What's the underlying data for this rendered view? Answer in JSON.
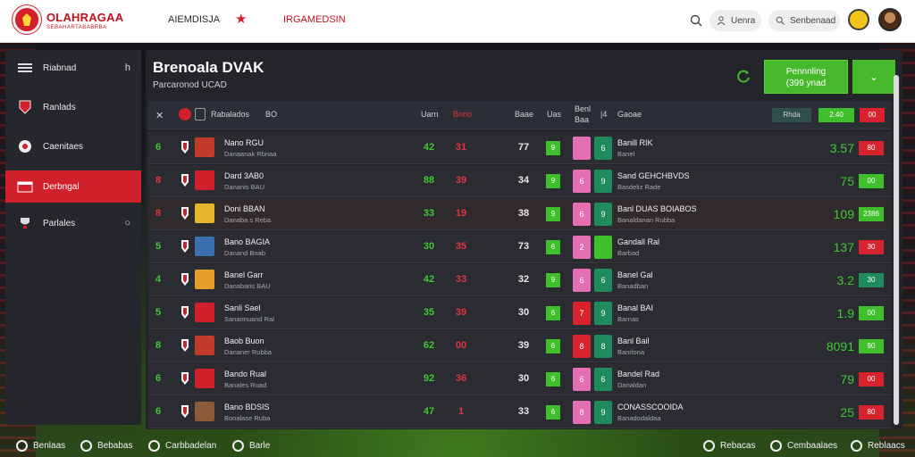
{
  "header": {
    "brand_title": "OLAHRAGAA",
    "brand_sub": "SEBAHARTABABRBA",
    "nav_primary": "AIEMDISJA",
    "nav_secondary": "IRGAMEDSIN",
    "pill_1": "Uenra",
    "pill_2": "Senbenaad"
  },
  "sidebar": {
    "items": [
      {
        "label": "Riabnad",
        "trail": "h"
      },
      {
        "label": "Ranlads",
        "trail": ""
      },
      {
        "label": "Caenitaes",
        "trail": ""
      },
      {
        "label": "Derbngal",
        "trail": ""
      },
      {
        "label": "Parlales",
        "trail": "○"
      }
    ]
  },
  "main": {
    "title": "Brenoala DVAK",
    "subtitle": "Parcaronod UCAD",
    "btn_primary_line1": "Pennnling",
    "btn_primary_line2": "(399 ynad",
    "btn_square": "⌄"
  },
  "table": {
    "headers": {
      "col_a": "Rabalados",
      "col_b": "BO",
      "col_c": "Uarn",
      "col_d": "Bnno",
      "col_e": "Baae",
      "col_f": "Uas",
      "col_g": "Benl",
      "col_g2": "Baa",
      "col_h": "Gaoae",
      "pill_1": "Rhda",
      "pill_2": "2.40",
      "pill_3": "00"
    },
    "rows": [
      {
        "rank": "6",
        "pname": "Nano RGU",
        "pteam": "Danaanak Rbnaa",
        "v1": "42",
        "v2": "31",
        "v3": "77",
        "b1": "9",
        "b2": "",
        "b3": "6",
        "mname": "Banill RIK",
        "mteam": "Banel",
        "score": "3.57",
        "delta": "80"
      },
      {
        "rank": "8",
        "pname": "Dard 3AB0",
        "pteam": "Dananis BAU",
        "v1": "88",
        "v2": "39",
        "v3": "34",
        "b1": "9",
        "b2": "6",
        "b3": "9",
        "mname": "Sand GEHCHBVDS",
        "mteam": "Basdeliz Rade",
        "score": "75",
        "delta": "00"
      },
      {
        "rank": "8",
        "pname": "Doni BBAN",
        "pteam": "Danaba s Reba",
        "v1": "33",
        "v2": "19",
        "v3": "38",
        "b1": "9",
        "b2": "6",
        "b3": "9",
        "mname": "Banl DUAS BOIABOS",
        "mteam": "Banaldanan Rubba",
        "score": "109",
        "delta": "2386"
      },
      {
        "rank": "5",
        "pname": "Bano BAGIA",
        "pteam": "Danand Bnab",
        "v1": "30",
        "v2": "35",
        "v3": "73",
        "b1": "6",
        "b2": "2",
        "b3": "",
        "mname": "Gandall Ral",
        "mteam": "Barbad",
        "score": "137",
        "delta": "30"
      },
      {
        "rank": "4",
        "pname": "Banel Garr",
        "pteam": "Danabaris BAU",
        "v1": "42",
        "v2": "33",
        "v3": "32",
        "b1": "9",
        "b2": "6",
        "b3": "6",
        "mname": "Banel Gal",
        "mteam": "Banadban",
        "score": "3.2",
        "delta": "30"
      },
      {
        "rank": "5",
        "pname": "Sanli Sael",
        "pteam": "Sanannuand Ral",
        "v1": "35",
        "v2": "39",
        "v3": "30",
        "b1": "6",
        "b2": "7",
        "b3": "9",
        "mname": "Banal BAI",
        "mteam": "Barnas",
        "score": "1.9",
        "delta": "00"
      },
      {
        "rank": "8",
        "pname": "Baob Buon",
        "pteam": "Dananer Rubba",
        "v1": "62",
        "v2": "00",
        "v3": "39",
        "b1": "6",
        "b2": "8",
        "b3": "8",
        "mname": "Banl Bail",
        "mteam": "Banrlona",
        "score": "8091",
        "delta": "90"
      },
      {
        "rank": "6",
        "pname": "Bando Rual",
        "pteam": "Banales Ruad",
        "v1": "92",
        "v2": "36",
        "v3": "30",
        "b1": "6",
        "b2": "6",
        "b3": "6",
        "mname": "Bandel Rad",
        "mteam": "Danaldan",
        "score": "79",
        "delta": "00"
      },
      {
        "rank": "6",
        "pname": "Bano BDSIS",
        "pteam": "Bonalase Ruba",
        "v1": "47",
        "v2": "1",
        "v3": "33",
        "b1": "6",
        "b2": "8",
        "b3": "9",
        "mname": "CONASSCOOIDA",
        "mteam": "Banadodaldaa",
        "score": "25",
        "delta": "80"
      }
    ]
  },
  "footer": {
    "items": [
      "Benlaas",
      "Bebabas",
      "Carbbadelan",
      "Barle",
      "Rebacas",
      "Cembaalaes",
      "Reblaacs"
    ]
  },
  "colors": {
    "accent_red": "#d0202b",
    "accent_green": "#46b82b",
    "panel": "#23252b"
  }
}
